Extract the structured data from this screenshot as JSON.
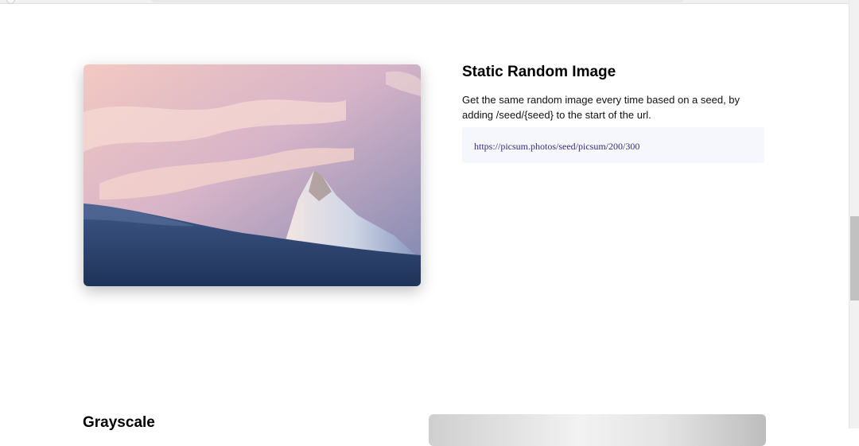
{
  "section_static": {
    "title": "Static Random Image",
    "description": "Get the same random image every time based on a seed, by adding /seed/{seed} to the start of the url.",
    "example_url": "https://picsum.photos/seed/picsum/200/300",
    "image_subject": "snow-covered mountain peak at sunset"
  },
  "section_grayscale": {
    "title": "Grayscale"
  },
  "colors": {
    "background": "#ffffff",
    "code_bg": "#f5f7fc",
    "link": "#3b2a7a"
  }
}
